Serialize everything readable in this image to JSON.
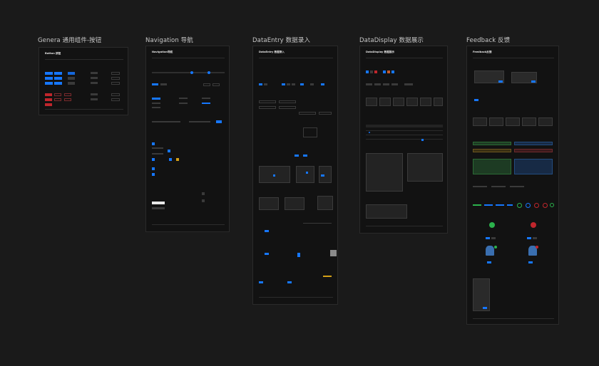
{
  "columns": [
    {
      "title": "Genera 通用组件-按钮",
      "board_title": "Button 按钮"
    },
    {
      "title": "Navigation 导航",
      "board_title": "Navigation导航"
    },
    {
      "title": "DataEntry 数据录入",
      "board_title": "DataEntry 数据录入"
    },
    {
      "title": "DataDisplay 数据展示",
      "board_title": "DataDisplay 数据展示"
    },
    {
      "title": "Feedback 反馈",
      "board_title": "Feedback反馈"
    }
  ],
  "colors": {
    "background": "#1a1a1a",
    "board": "#121212",
    "primary": "#1677ff",
    "danger": "#c0262c",
    "success": "#2bb24c",
    "warning": "#d4a017"
  }
}
